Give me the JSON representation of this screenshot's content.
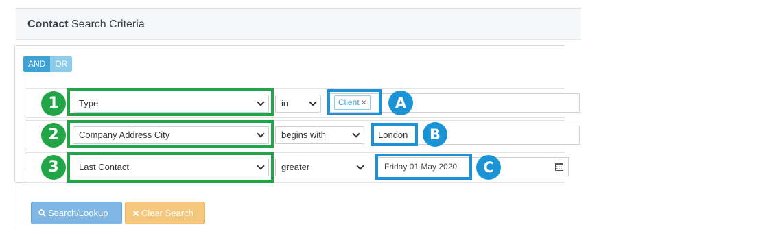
{
  "panel": {
    "title_bold": "Contact",
    "title_rest": " Search Criteria"
  },
  "conjunction": {
    "and_label": "AND",
    "or_label": "OR",
    "selected": "AND"
  },
  "rules": [
    {
      "badge": "1",
      "field": "Type",
      "operator": "in",
      "value_badge": "A",
      "value_tag": "Client",
      "value_tag_remove": "×"
    },
    {
      "badge": "2",
      "field": "Company Address City",
      "operator": "begins with",
      "value_badge": "B",
      "value": "London"
    },
    {
      "badge": "3",
      "field": "Last Contact",
      "operator": "greater",
      "value_badge": "C",
      "value": "Friday 01 May 2020",
      "value_icon": "calendar-icon"
    }
  ],
  "buttons": {
    "search_label": "Search/Lookup",
    "search_icon": "search-icon",
    "clear_label": "Clear Search",
    "clear_icon": "close-icon"
  },
  "colors": {
    "annotation_green": "#21a546",
    "annotation_blue": "#1a94d6",
    "and_active": "#3fa2d6",
    "or_inactive": "#8ccbea",
    "search_button": "#7fb6e4",
    "clear_button": "#f4c77d"
  }
}
